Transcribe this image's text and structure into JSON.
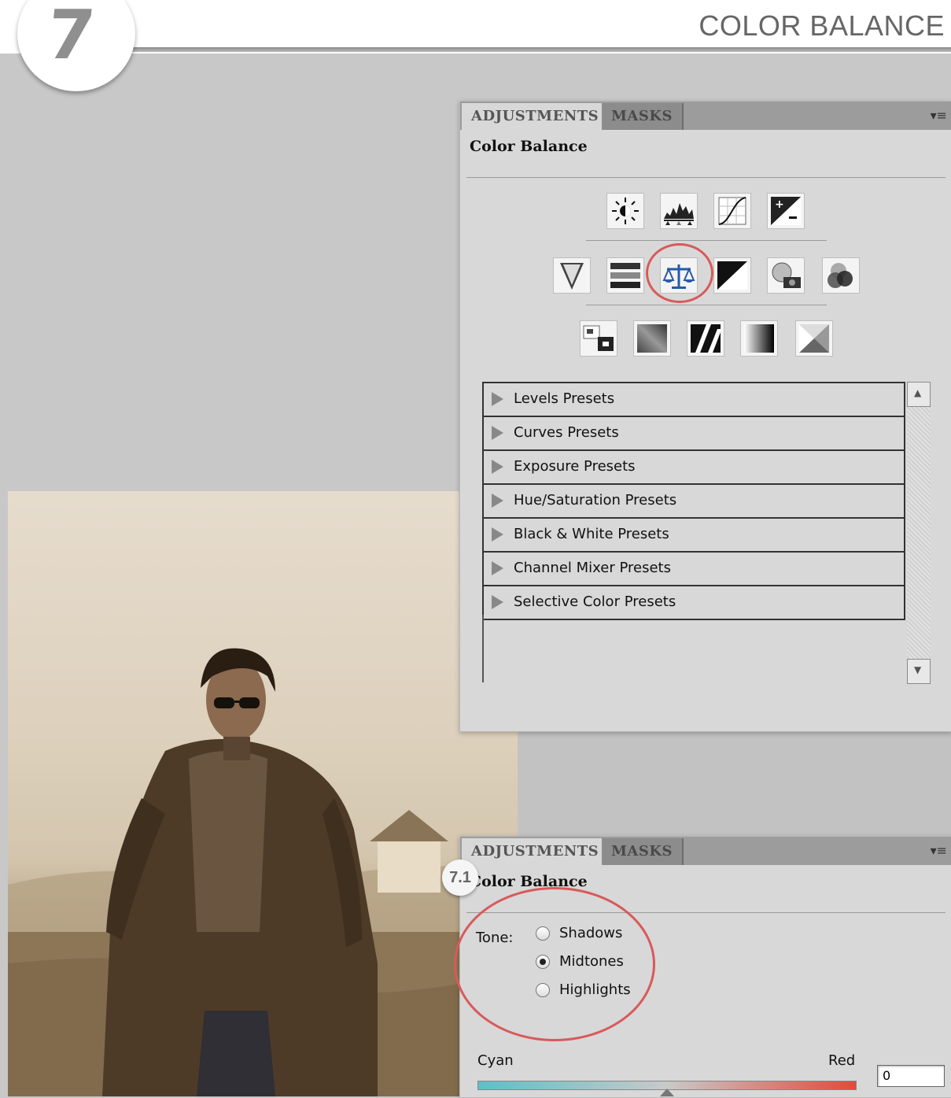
{
  "header": {
    "step_number": "7",
    "title": "COLOR BALANCE"
  },
  "panel1": {
    "tabs": [
      "ADJUSTMENTS",
      "MASKS"
    ],
    "heading": "Color Balance",
    "icon_rows": [
      [
        "brightness-contrast-icon",
        "levels-icon",
        "curves-icon",
        "exposure-icon"
      ],
      [
        "vibrance-icon",
        "hue-saturation-icon",
        "color-balance-icon",
        "black-white-icon",
        "photo-filter-icon",
        "channel-mixer-icon"
      ],
      [
        "invert-icon",
        "posterize-icon",
        "threshold-icon",
        "gradient-map-icon",
        "selective-color-icon"
      ]
    ],
    "selected_icon": "color-balance-icon",
    "presets": [
      "Levels Presets",
      "Curves Presets",
      "Exposure Presets",
      "Hue/Saturation Presets",
      "Black & White Presets",
      "Channel Mixer Presets",
      "Selective Color Presets"
    ]
  },
  "panel2": {
    "step_badge": "7.1",
    "tabs": [
      "ADJUSTMENTS",
      "MASKS"
    ],
    "heading": "Color Balance",
    "tone_label": "Tone:",
    "tone_options": [
      "Shadows",
      "Midtones",
      "Highlights"
    ],
    "tone_selected": "Midtones",
    "slider": {
      "left_label": "Cyan",
      "right_label": "Red",
      "value": "0"
    }
  },
  "colors": {
    "highlight_circle": "#d85a5a",
    "sepia_photo": "#c8b89c"
  }
}
